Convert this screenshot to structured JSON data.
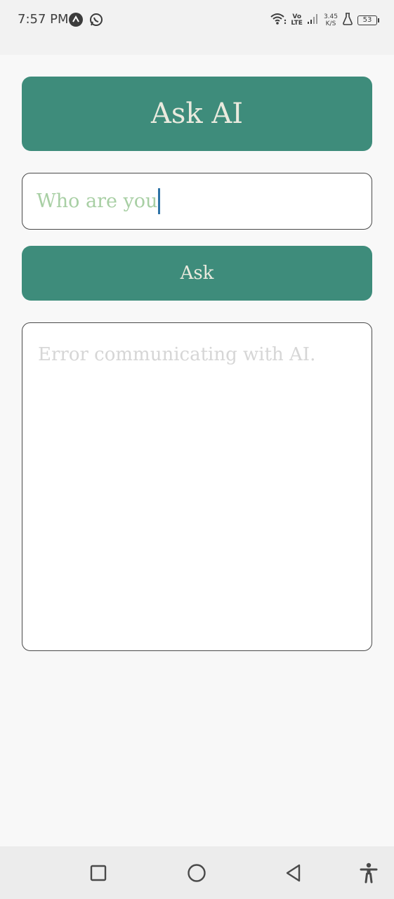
{
  "status_bar": {
    "time": "7:57 PM",
    "notification_icons": [
      "app-notification-icon",
      "whatsapp-icon"
    ],
    "volte_top": "Vo",
    "volte_bottom": "LTE",
    "net_speed_value": "3.45",
    "net_speed_unit": "K/S",
    "battery_level": "53"
  },
  "app": {
    "title": "Ask AI",
    "input": {
      "value": "Who are you"
    },
    "ask_button_label": "Ask",
    "response_text": "Error communicating with AI."
  },
  "nav_bar": {
    "icons": [
      "recent-apps-icon",
      "home-icon",
      "back-icon",
      "accessibility-icon"
    ]
  },
  "colors": {
    "accent": "#3e8c7b",
    "button_text": "#eaeade",
    "input_text": "#a8cfa4",
    "placeholder_text": "#d6d6d6",
    "caret": "#2e73a6"
  }
}
